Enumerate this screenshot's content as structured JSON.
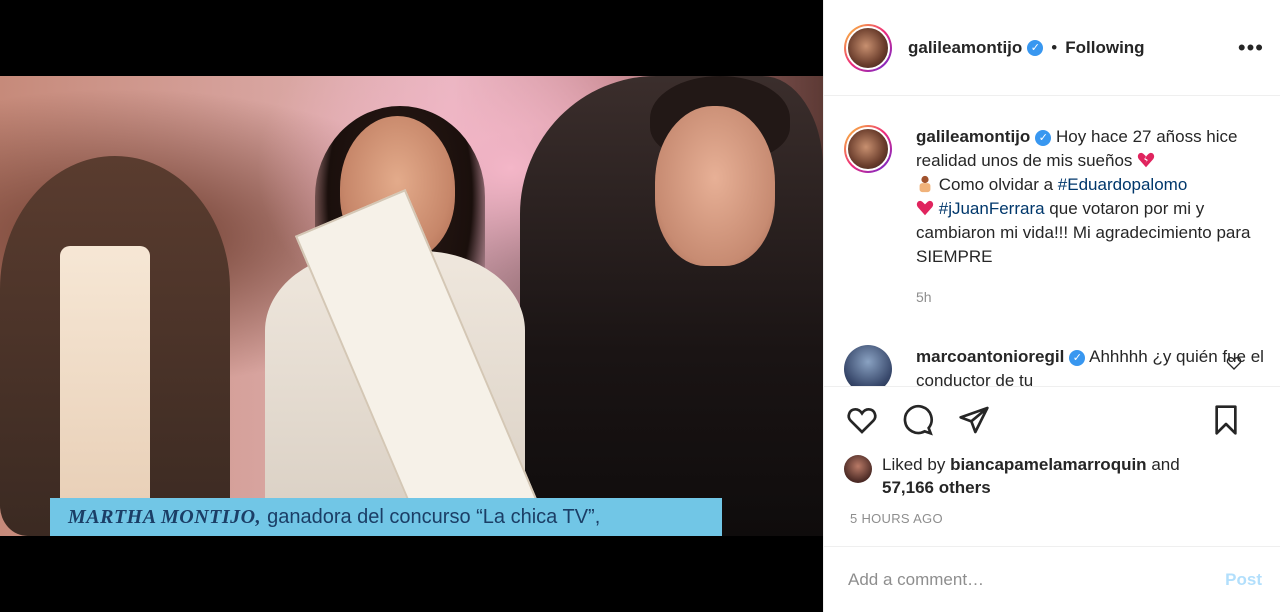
{
  "post": {
    "caption_overlay_bold": "MARTHA MONTIJO,",
    "caption_overlay_rest": "ganadora del concurso “La chica TV”,"
  },
  "header": {
    "username": "galileamontijo",
    "dot": "•",
    "follow_state": "Following",
    "more_label": "•••"
  },
  "caption": {
    "username": "galileamontijo",
    "text_1": "Hoy hace 27 añoss hice realidad unos de mis sueños",
    "text_2": "Como olvidar a",
    "tag_1": "#Eduardopalomo",
    "tag_2": "#jJuanFerrara",
    "text_3": "que votaron por mi y cambiaron mi vida!!! Mi agradecimiento para SIEMPRE",
    "time": "5h"
  },
  "reply": {
    "username": "marcoantonioregil",
    "text": "Ahhhhh ¿y quién fue el conductor de tu"
  },
  "likes": {
    "prefix": "Liked by",
    "user": "biancapamelamarroquin",
    "and": "and",
    "count": "57,166 others"
  },
  "timestamp": "5 HOURS AGO",
  "comment_box": {
    "placeholder": "Add a comment…",
    "post_label": "Post"
  },
  "colors": {
    "link": "#00376b",
    "verified": "#3897f0",
    "post_disabled": "#b2dffc",
    "caption_banner": "#71c6e6"
  }
}
